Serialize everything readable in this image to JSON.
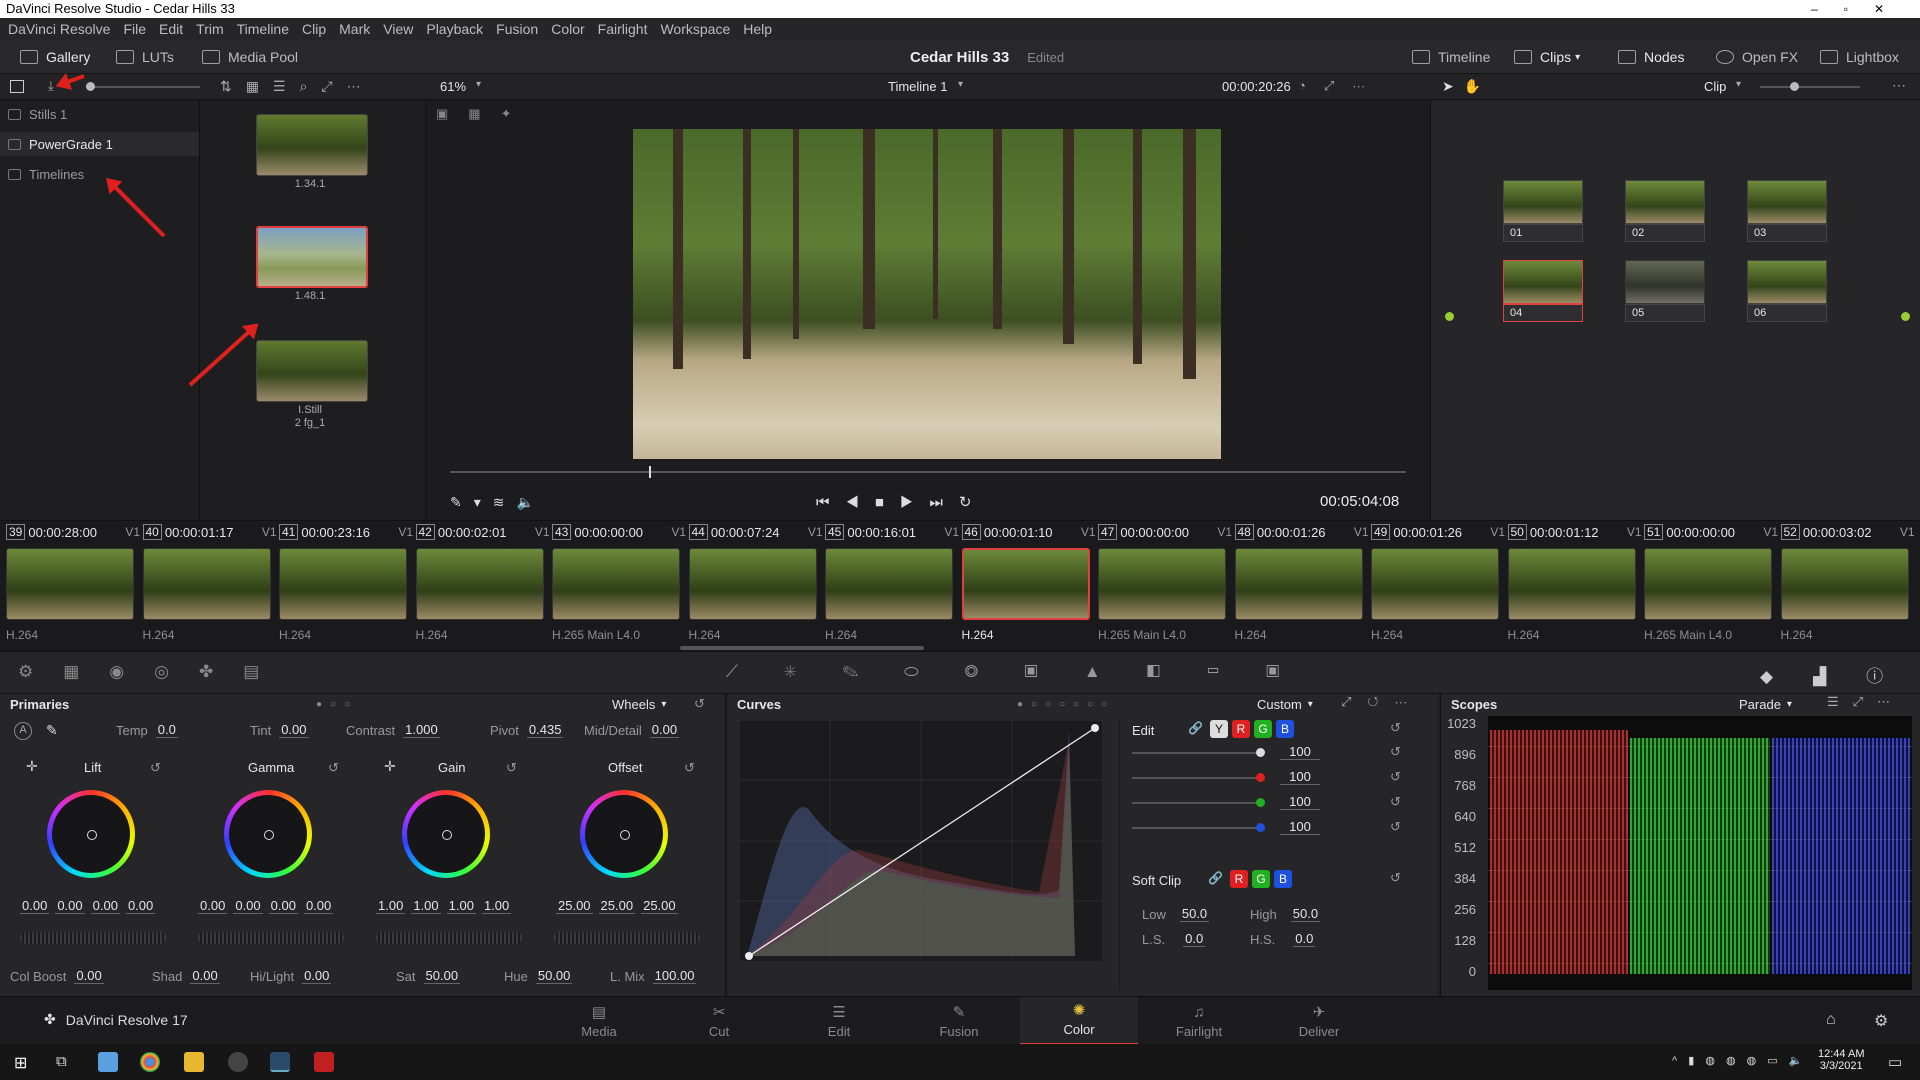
{
  "window": {
    "title": "DaVinci Resolve Studio - Cedar Hills 33"
  },
  "menu": [
    "DaVinci Resolve",
    "File",
    "Edit",
    "Trim",
    "Timeline",
    "Clip",
    "Mark",
    "View",
    "Playback",
    "Fusion",
    "Color",
    "Fairlight",
    "Workspace",
    "Help"
  ],
  "toolbar": {
    "gallery": "Gallery",
    "luts": "LUTs",
    "media_pool": "Media Pool",
    "project": "Cedar Hills 33",
    "status": "Edited",
    "timeline": "Timeline",
    "clips": "Clips",
    "nodes": "Nodes",
    "openfx": "Open FX",
    "lightbox": "Lightbox"
  },
  "viewer": {
    "zoom": "61%",
    "timeline_name": "Timeline 1",
    "timecode": "00:00:20:26",
    "playhead_tc": "00:05:04:08",
    "mode": "Clip"
  },
  "gallery": {
    "albums": [
      "Stills 1",
      "PowerGrade 1",
      "Timelines"
    ],
    "stills": [
      "1.34.1",
      "1.48.1",
      "I.Still",
      "2 fg_1"
    ]
  },
  "clips": [
    {
      "num": "39",
      "tc": "00:00:28:00",
      "track": "V1",
      "codec": "H.264"
    },
    {
      "num": "40",
      "tc": "00:00:01:17",
      "track": "V1",
      "codec": "H.264"
    },
    {
      "num": "41",
      "tc": "00:00:23:16",
      "track": "V1",
      "codec": "H.264"
    },
    {
      "num": "42",
      "tc": "00:00:02:01",
      "track": "V1",
      "codec": "H.264"
    },
    {
      "num": "43",
      "tc": "00:00:00:00",
      "track": "V1",
      "codec": "H.265 Main L4.0"
    },
    {
      "num": "44",
      "tc": "00:00:07:24",
      "track": "V1",
      "codec": "H.264"
    },
    {
      "num": "45",
      "tc": "00:00:16:01",
      "track": "V1",
      "codec": "H.264"
    },
    {
      "num": "46",
      "tc": "00:00:01:10",
      "track": "V1",
      "codec": "H.264"
    },
    {
      "num": "47",
      "tc": "00:00:00:00",
      "track": "V1",
      "codec": "H.265 Main L4.0"
    },
    {
      "num": "48",
      "tc": "00:00:01:26",
      "track": "V1",
      "codec": "H.264"
    },
    {
      "num": "49",
      "tc": "00:00:01:26",
      "track": "V1",
      "codec": "H.264"
    },
    {
      "num": "50",
      "tc": "00:00:01:12",
      "track": "V1",
      "codec": "H.264"
    },
    {
      "num": "51",
      "tc": "00:00:00:00",
      "track": "V1",
      "codec": "H.265 Main L4.0"
    },
    {
      "num": "52",
      "tc": "00:00:03:02",
      "track": "V1",
      "codec": "H.264"
    }
  ],
  "nodes": [
    "01",
    "02",
    "03",
    "04",
    "05",
    "06"
  ],
  "primaries": {
    "title": "Primaries",
    "mode": "Wheels",
    "temp_label": "Temp",
    "temp": "0.0",
    "tint_label": "Tint",
    "tint": "0.00",
    "contrast_label": "Contrast",
    "contrast": "1.000",
    "pivot_label": "Pivot",
    "pivot": "0.435",
    "middetail_label": "Mid/Detail",
    "middetail": "0.00",
    "wheels": [
      {
        "name": "Lift",
        "vals": [
          "0.00",
          "0.00",
          "0.00",
          "0.00"
        ]
      },
      {
        "name": "Gamma",
        "vals": [
          "0.00",
          "0.00",
          "0.00",
          "0.00"
        ]
      },
      {
        "name": "Gain",
        "vals": [
          "1.00",
          "1.00",
          "1.00",
          "1.00"
        ]
      },
      {
        "name": "Offset",
        "vals": [
          "25.00",
          "25.00",
          "25.00"
        ]
      }
    ],
    "colboost_label": "Col Boost",
    "colboost": "0.00",
    "shad_label": "Shad",
    "shad": "0.00",
    "hilight_label": "Hi/Light",
    "hilight": "0.00",
    "sat_label": "Sat",
    "sat": "50.00",
    "hue_label": "Hue",
    "hue": "50.00",
    "lmix_label": "L. Mix",
    "lmix": "100.00"
  },
  "curves": {
    "title": "Curves",
    "mode": "Custom",
    "edit_label": "Edit",
    "channels": [
      "Y",
      "R",
      "G",
      "B"
    ],
    "intensity": [
      "100",
      "100",
      "100",
      "100"
    ],
    "softclip_label": "Soft Clip",
    "low_label": "Low",
    "low": "50.0",
    "high_label": "High",
    "high": "50.0",
    "ls_label": "L.S.",
    "ls": "0.0",
    "hs_label": "H.S.",
    "hs": "0.0"
  },
  "scopes": {
    "title": "Scopes",
    "mode": "Parade",
    "ylabels": [
      "1023",
      "896",
      "768",
      "640",
      "512",
      "384",
      "256",
      "128",
      "0"
    ]
  },
  "pages": [
    "Media",
    "Cut",
    "Edit",
    "Fusion",
    "Color",
    "Fairlight",
    "Deliver"
  ],
  "app_label": "DaVinci Resolve 17",
  "taskbar": {
    "time": "12:44 AM",
    "date": "3/3/2021"
  },
  "colors": {
    "accent": "#e04040",
    "red": "#e02020",
    "green": "#20b020",
    "blue": "#2050e0"
  }
}
